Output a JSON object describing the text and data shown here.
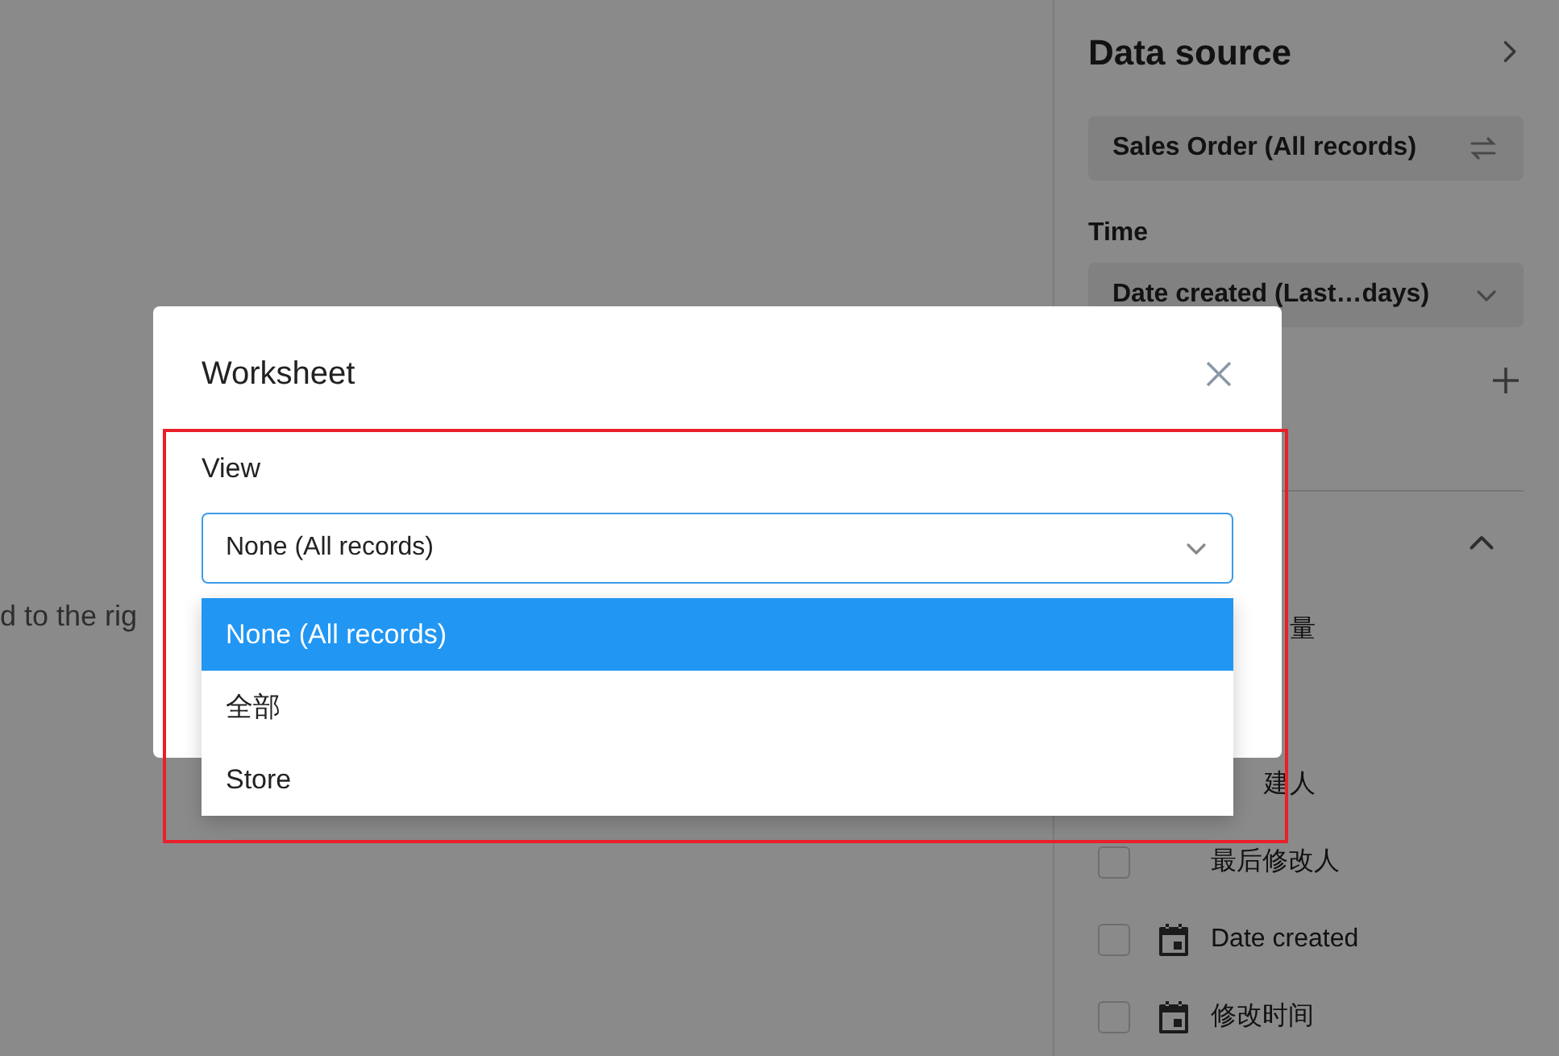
{
  "canvas": {
    "hint": "d to the rig"
  },
  "sidebar": {
    "title": "Data source",
    "data_source": {
      "value": "Sales Order (All records)"
    },
    "time": {
      "label": "Time",
      "value": "Date created (Last…days)"
    },
    "section": {
      "expanded": true
    },
    "fields": [
      {
        "kind": "clipped",
        "label": "量"
      },
      {
        "kind": "covered"
      },
      {
        "kind": "clipped",
        "label": "建人"
      },
      {
        "kind": "text",
        "label": "最后修改人",
        "checked": false
      },
      {
        "kind": "date",
        "label": "Date created",
        "checked": false
      },
      {
        "kind": "date",
        "label": "修改时间",
        "checked": false
      }
    ]
  },
  "modal": {
    "title": "Worksheet",
    "view_label": "View",
    "select": {
      "value": "None (All records)",
      "expanded": true
    },
    "options": [
      {
        "label": "None (All records)",
        "selected": true
      },
      {
        "label": "全部",
        "selected": false
      },
      {
        "label": "Store",
        "selected": false
      }
    ]
  }
}
